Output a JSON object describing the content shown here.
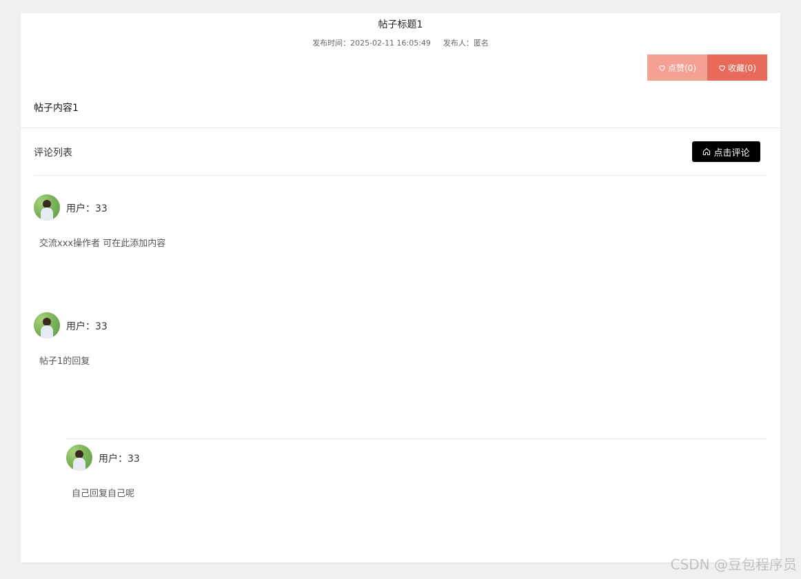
{
  "post": {
    "title": "帖子标题1",
    "publish_time_label": "发布时间：",
    "publish_time": "2025-02-11 16:05:49",
    "publisher_label": "发布人：",
    "publisher": "匿名",
    "like_label": "点赞(0)",
    "favorite_label": "收藏(0)",
    "content": "帖子内容1"
  },
  "colors": {
    "like_button": "#f4a193",
    "favorite_button": "#e9695a",
    "comment_button": "#000000"
  },
  "comments": {
    "header_title": "评论列表",
    "comment_button_label": "点击评论",
    "items": [
      {
        "user": "用户：33",
        "text": "交流xxx操作者 可在此添加内容"
      },
      {
        "user": "用户：33",
        "text": "帖子1的回复"
      }
    ],
    "replies": [
      {
        "user": "用户：33",
        "text": "自己回复自己呢"
      }
    ]
  },
  "watermark": "CSDN @豆包程序员"
}
